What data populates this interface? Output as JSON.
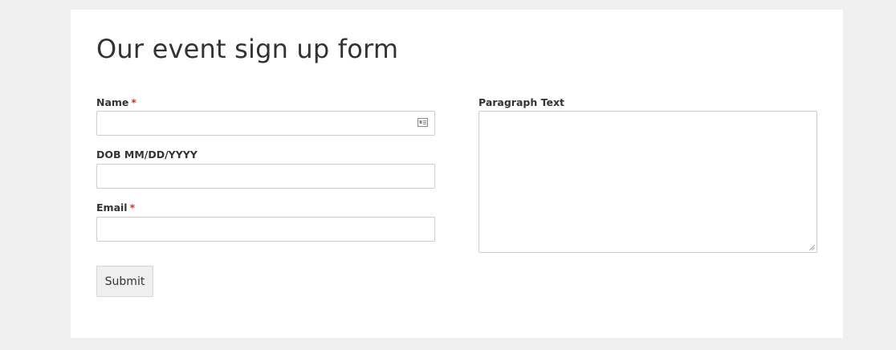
{
  "form": {
    "title": "Our event sign up form",
    "fields": {
      "name": {
        "label": "Name",
        "required_mark": "*",
        "value": ""
      },
      "dob": {
        "label": "DOB MM/DD/YYYY",
        "value": ""
      },
      "email": {
        "label": "Email",
        "required_mark": "*",
        "value": ""
      },
      "paragraph": {
        "label": "Paragraph Text",
        "value": ""
      }
    },
    "submit_label": "Submit"
  },
  "colors": {
    "page_background": "#efefef",
    "card_background": "#ffffff",
    "required_mark": "#c0392b",
    "input_border": "#cccccc",
    "button_background": "#efefef"
  },
  "icons": {
    "name_field_icon": "contact-card-icon",
    "textarea_resize": "resize-handle-icon"
  }
}
